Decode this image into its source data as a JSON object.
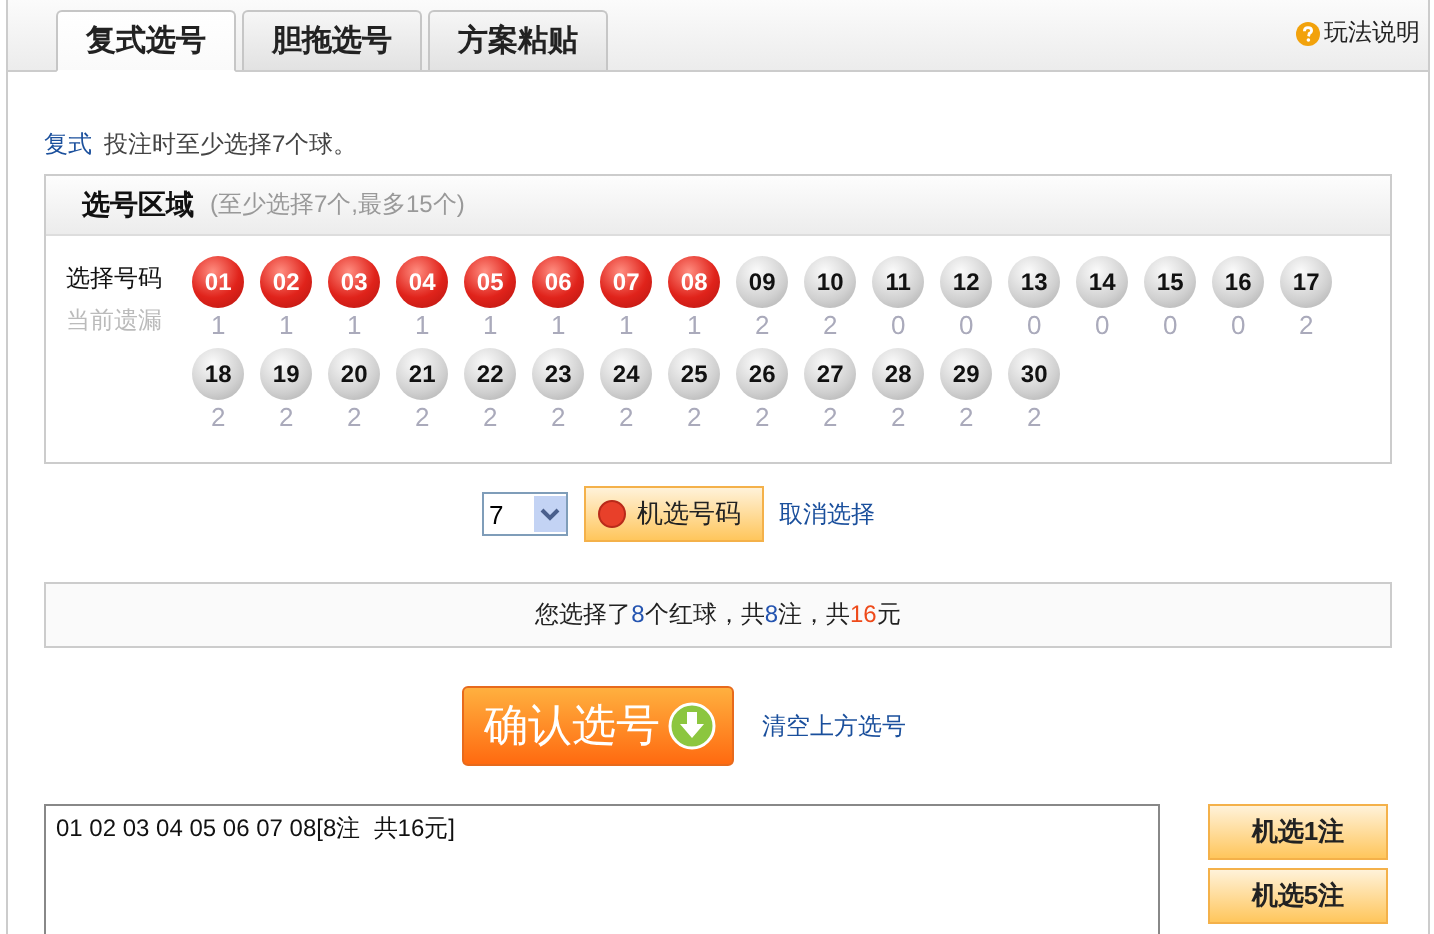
{
  "tabs": [
    {
      "label": "复式选号",
      "selected": true
    },
    {
      "label": "胆拖选号",
      "selected": false
    },
    {
      "label": "方案粘贴",
      "selected": false
    }
  ],
  "help_link": "玩法说明",
  "intro": {
    "link": "复式",
    "text": "投注时至少选择7个球。"
  },
  "pick_area": {
    "title": "选号区域",
    "hint": "(至少选择7个,最多15个)",
    "row_label": "选择号码",
    "miss_label": "当前遗漏",
    "balls": [
      {
        "number": "01",
        "miss": "1",
        "selected": true
      },
      {
        "number": "02",
        "miss": "1",
        "selected": true
      },
      {
        "number": "03",
        "miss": "1",
        "selected": true
      },
      {
        "number": "04",
        "miss": "1",
        "selected": true
      },
      {
        "number": "05",
        "miss": "1",
        "selected": true
      },
      {
        "number": "06",
        "miss": "1",
        "selected": true
      },
      {
        "number": "07",
        "miss": "1",
        "selected": true
      },
      {
        "number": "08",
        "miss": "1",
        "selected": true
      },
      {
        "number": "09",
        "miss": "2",
        "selected": false
      },
      {
        "number": "10",
        "miss": "2",
        "selected": false
      },
      {
        "number": "11",
        "miss": "0",
        "selected": false
      },
      {
        "number": "12",
        "miss": "0",
        "selected": false
      },
      {
        "number": "13",
        "miss": "0",
        "selected": false
      },
      {
        "number": "14",
        "miss": "0",
        "selected": false
      },
      {
        "number": "15",
        "miss": "0",
        "selected": false
      },
      {
        "number": "16",
        "miss": "0",
        "selected": false
      },
      {
        "number": "17",
        "miss": "2",
        "selected": false
      },
      {
        "number": "18",
        "miss": "2",
        "selected": false
      },
      {
        "number": "19",
        "miss": "2",
        "selected": false
      },
      {
        "number": "20",
        "miss": "2",
        "selected": false
      },
      {
        "number": "21",
        "miss": "2",
        "selected": false
      },
      {
        "number": "22",
        "miss": "2",
        "selected": false
      },
      {
        "number": "23",
        "miss": "2",
        "selected": false
      },
      {
        "number": "24",
        "miss": "2",
        "selected": false
      },
      {
        "number": "25",
        "miss": "2",
        "selected": false
      },
      {
        "number": "26",
        "miss": "2",
        "selected": false
      },
      {
        "number": "27",
        "miss": "2",
        "selected": false
      },
      {
        "number": "28",
        "miss": "2",
        "selected": false
      },
      {
        "number": "29",
        "miss": "2",
        "selected": false
      },
      {
        "number": "30",
        "miss": "2",
        "selected": false
      }
    ]
  },
  "random_pick": {
    "count": "7",
    "button": "机选号码",
    "cancel_link": "取消选择"
  },
  "summary": [
    {
      "kind": "plain",
      "text": "您选择了"
    },
    {
      "kind": "count",
      "text": "8"
    },
    {
      "kind": "plain",
      "text": "个红球，共"
    },
    {
      "kind": "count",
      "text": "8"
    },
    {
      "kind": "plain",
      "text": "注，共"
    },
    {
      "kind": "amount",
      "text": "16"
    },
    {
      "kind": "plain",
      "text": "元"
    }
  ],
  "confirm_button": "确认选号",
  "clear_link": "清空上方选号",
  "bet_list": "01 02 03 04 05 06 07 08[8注  共16元]",
  "quick_buttons": [
    "机选1注",
    "机选5注"
  ]
}
